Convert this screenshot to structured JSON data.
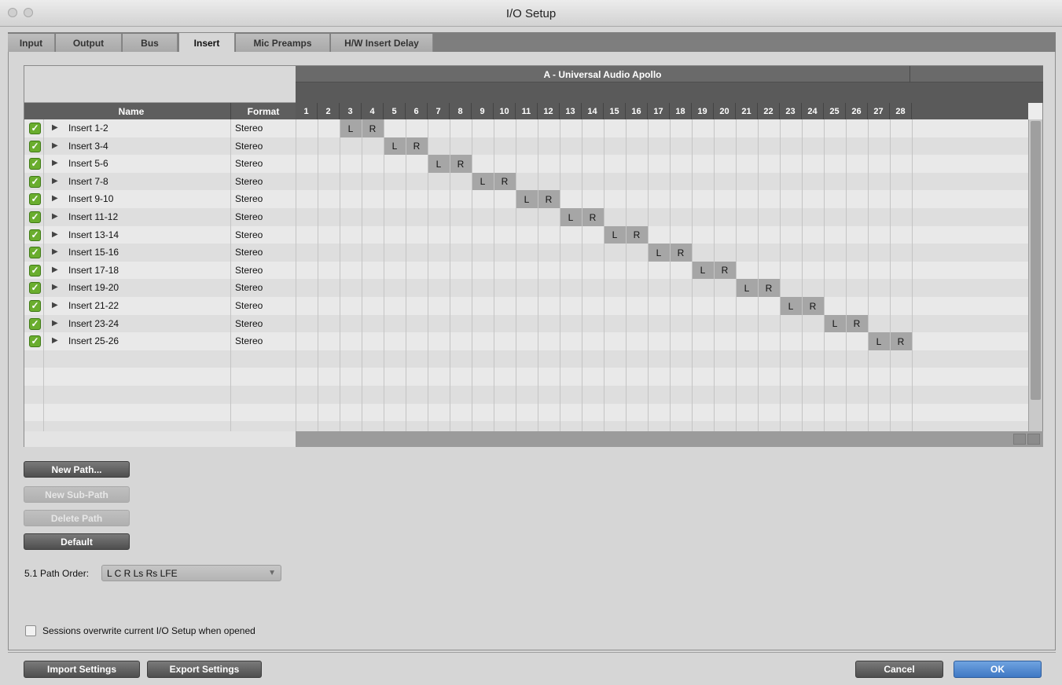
{
  "window": {
    "title": "I/O Setup"
  },
  "tabs": [
    "Input",
    "Output",
    "Bus",
    "Insert",
    "Mic Preamps",
    "H/W Insert Delay"
  ],
  "grid": {
    "device": "A - Universal Audio Apollo",
    "name_header": "Name",
    "format_header": "Format",
    "channels": [
      "1",
      "2",
      "3",
      "4",
      "5",
      "6",
      "7",
      "8",
      "9",
      "10",
      "11",
      "12",
      "13",
      "14",
      "15",
      "16",
      "17",
      "18",
      "19",
      "20",
      "21",
      "22",
      "23",
      "24",
      "25",
      "26",
      "27",
      "28"
    ],
    "rows": [
      {
        "name": "Insert 1-2",
        "format": "Stereo",
        "L": 3,
        "R": 4
      },
      {
        "name": "Insert 3-4",
        "format": "Stereo",
        "L": 5,
        "R": 6
      },
      {
        "name": "Insert 5-6",
        "format": "Stereo",
        "L": 7,
        "R": 8
      },
      {
        "name": "Insert 7-8",
        "format": "Stereo",
        "L": 9,
        "R": 10
      },
      {
        "name": "Insert 9-10",
        "format": "Stereo",
        "L": 11,
        "R": 12
      },
      {
        "name": "Insert 11-12",
        "format": "Stereo",
        "L": 13,
        "R": 14
      },
      {
        "name": "Insert 13-14",
        "format": "Stereo",
        "L": 15,
        "R": 16
      },
      {
        "name": "Insert 15-16",
        "format": "Stereo",
        "L": 17,
        "R": 18
      },
      {
        "name": "Insert 17-18",
        "format": "Stereo",
        "L": 19,
        "R": 20
      },
      {
        "name": "Insert 19-20",
        "format": "Stereo",
        "L": 21,
        "R": 22
      },
      {
        "name": "Insert 21-22",
        "format": "Stereo",
        "L": 23,
        "R": 24
      },
      {
        "name": "Insert 23-24",
        "format": "Stereo",
        "L": 25,
        "R": 26
      },
      {
        "name": "Insert 25-26",
        "format": "Stereo",
        "L": 27,
        "R": 28
      }
    ],
    "assign_left": "L",
    "assign_right": "R"
  },
  "buttons": {
    "new_path": "New Path...",
    "new_sub_path": "New Sub-Path",
    "delete_path": "Delete Path",
    "default": "Default"
  },
  "path_order": {
    "label": "5.1 Path Order:",
    "value": "L C R Ls Rs LFE"
  },
  "overwrite_checkbox": {
    "label": "Sessions overwrite current I/O Setup when opened",
    "checked": false
  },
  "footer": {
    "import": "Import Settings",
    "export": "Export Settings",
    "cancel": "Cancel",
    "ok": "OK"
  },
  "colors": {
    "check_green": "#6aad2e",
    "ok_blue": "#3f78c4",
    "header_dark": "#5e5e5e"
  },
  "icons": {
    "check": "checkmark-icon",
    "expand": "disclosure-triangle-icon",
    "dropdown": "chevron-down-icon"
  }
}
